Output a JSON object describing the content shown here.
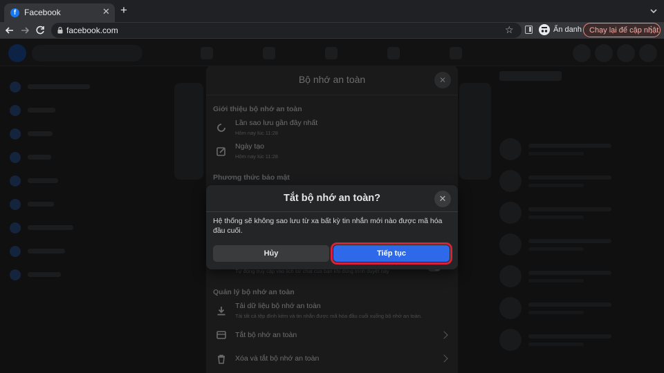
{
  "browser": {
    "tab_title": "Facebook",
    "tab_close": "✕",
    "new_tab": "+",
    "url": "facebook.com",
    "incognito_label": "Ẩn danh",
    "update_label": "Chạy lại để cập nhật",
    "update_menu": "⋮",
    "star": "☆"
  },
  "panel": {
    "title": "Bộ nhớ an toàn",
    "close": "✕",
    "sections": {
      "intro": "Giới thiệu bộ nhớ an toàn",
      "security": "Phương thức bảo mật",
      "manage": "Quản lý bộ nhớ an toàn"
    },
    "rows": {
      "last_backup": {
        "title": "Lần sao lưu gần đây nhất",
        "sub": "Hôm nay lúc 11:28"
      },
      "created": {
        "title": "Ngày tạo",
        "sub": "Hôm nay lúc 11:28"
      },
      "hidden_toggle_sub": "Tự động truy cập vào lịch sử chat của bạn khi dùng trình duyệt này",
      "download": {
        "title": "Tải dữ liệu bộ nhớ an toàn",
        "sub": "Tải tất cả tệp đính kèm và tin nhắn được mã hóa đầu cuối xuống bộ nhớ an toàn."
      },
      "turn_off": {
        "title": "Tắt bộ nhớ an toàn"
      },
      "delete_off": {
        "title": "Xóa và tắt bộ nhớ an toàn"
      }
    }
  },
  "dialog": {
    "title": "Tắt bộ nhớ an toàn?",
    "close": "✕",
    "body": "Hệ thống sẽ không sao lưu từ xa bất kỳ tin nhắn mới nào được mã hóa đầu cuối.",
    "cancel_label": "Hủy",
    "continue_label": "Tiếp tục"
  },
  "colors": {
    "primary": "#2d69e8",
    "highlight": "#d6233a",
    "dialog_bg": "#242526"
  }
}
